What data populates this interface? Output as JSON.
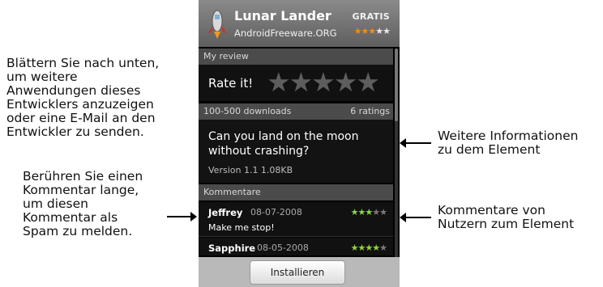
{
  "annotations": {
    "scroll_hint": [
      "Blättern Sie nach unten,",
      "um weitere",
      "Anwendungen dieses",
      "Entwicklers anzuzeigen",
      "oder eine E-Mail an den",
      "Entwickler zu senden."
    ],
    "long_press_hint": [
      "Berühren Sie einen",
      "Kommentar lange,",
      "um diesen",
      "Kommentar als",
      "Spam zu melden."
    ],
    "more_info": [
      "Weitere Informationen",
      "zu dem Element"
    ],
    "user_comments": [
      "Kommentare von",
      "Nutzern zum Element"
    ]
  },
  "app": {
    "title": "Lunar Lander",
    "developer": "AndroidFreeware.ORG",
    "price": "GRATIS",
    "stars_filled": "★★★",
    "stars_empty": "★★"
  },
  "review": {
    "header": "My review",
    "rate_label": "Rate it!",
    "big_stars": "★★★★★"
  },
  "stats": {
    "downloads": "100-500 downloads",
    "ratings": "6 ratings"
  },
  "description": {
    "text": "Can you land on the moon without crashing?",
    "version": "Version 1.1   1.08KB"
  },
  "comments": {
    "header": "Kommentare",
    "items": [
      {
        "name": "Jeffrey",
        "date": "08-07-2008",
        "stars_filled": "★★★",
        "stars_empty": "★★",
        "text": "Make me stop!"
      },
      {
        "name": "Sapphire",
        "date": "08-05-2008",
        "stars_filled": "★★★★",
        "stars_empty": "★",
        "text": ""
      }
    ]
  },
  "install_label": "Installieren",
  "colors": {
    "star_green": "#8fd63a",
    "star_orange": "#f08a1d",
    "star_empty": "#7a7a7a"
  }
}
